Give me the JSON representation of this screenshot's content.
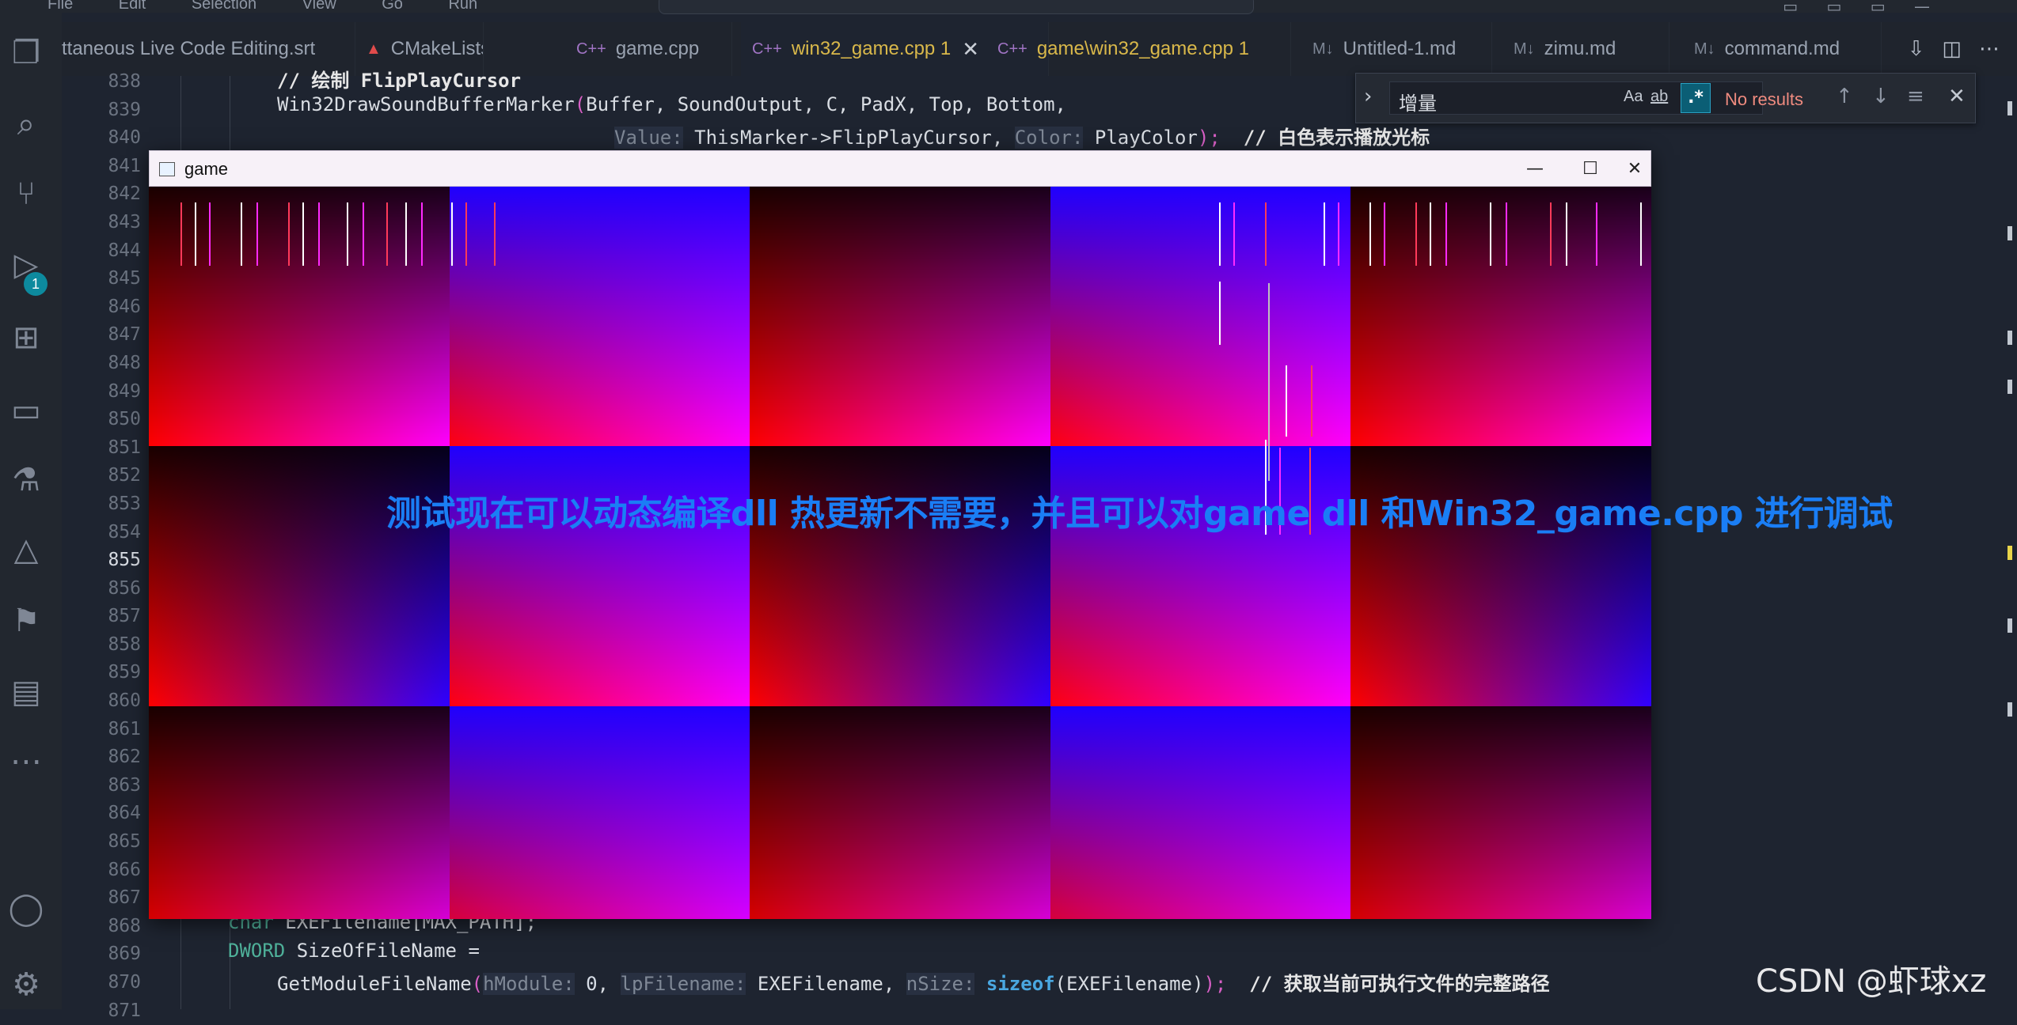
{
  "menu": [
    "File",
    "Edit",
    "Selection",
    "View",
    "Go",
    "Run"
  ],
  "tabs": [
    {
      "label": "ttaneous Live Code Editing.srt",
      "icon": "",
      "active": false
    },
    {
      "label": "CMakeLists.txt",
      "icon": "▲",
      "active": false
    },
    {
      "label": "game.cpp",
      "icon": "C++",
      "active": false
    },
    {
      "label": "win32_game.cpp 1",
      "icon": "C++",
      "active": true
    },
    {
      "label": "game\\win32_game.cpp 1",
      "icon": "C++",
      "active": false
    },
    {
      "label": "Untitled-1.md",
      "icon": "M↓",
      "active": false
    },
    {
      "label": "zimu.md",
      "icon": "M↓",
      "active": false
    },
    {
      "label": "command.md",
      "icon": "M↓",
      "active": false
    }
  ],
  "activity_badge": "1",
  "line_numbers": [
    "838",
    "839",
    "840",
    "841",
    "842",
    "843",
    "844",
    "845",
    "846",
    "847",
    "848",
    "849",
    "850",
    "851",
    "852",
    "853",
    "854",
    "855",
    "856",
    "857",
    "858",
    "859",
    "860",
    "861",
    "862",
    "863",
    "864",
    "865",
    "866",
    "867",
    "868",
    "869",
    "870",
    "871"
  ],
  "current_line": "855",
  "code": {
    "l838_comment": "// 绘制 FlipPlayCursor",
    "l839_call": "Win32DrawSoundBufferMarker",
    "l839_args": "Buffer, SoundOutput, C, PadX, Top, Bottom,",
    "l840_hint1": "Value:",
    "l840_val": " ThisMarker->FlipPlayCursor, ",
    "l840_hint2": "Color:",
    "l840_val2": " PlayColor",
    "l840_end": ");",
    "l840_comment": "// 白色表示播放光标",
    "l868_type": "char",
    "l868_rest": " EXEFilename[MAX_PATH];",
    "l869_type": "DWORD",
    "l869_rest": " SizeOfFileName =",
    "l870_fn": "GetModuleFileName",
    "l870_hint1": "hModule:",
    "l870_v1": " 0",
    "l870_hint2": "lpFilename:",
    "l870_v2": " EXEFilename, ",
    "l870_hint3": "nSize:",
    "l870_kw": " sizeof",
    "l870_v3": "(EXEFilename)",
    "l870_end": ");",
    "l870_comment": "// 获取当前可执行文件的完整路径"
  },
  "find": {
    "query": "增量",
    "match_case": "Aa",
    "whole_word": "ab",
    "regex": ".*",
    "result": "No results"
  },
  "game_window": {
    "title": "game",
    "minimize": "—",
    "maximize": "☐",
    "close": "✕"
  },
  "overlay_caption": "测试现在可以动态编译dll 热更新不需要，并且可以对game dll 和Win32_game.cpp 进行调试",
  "watermark": "CSDN @虾球xz"
}
